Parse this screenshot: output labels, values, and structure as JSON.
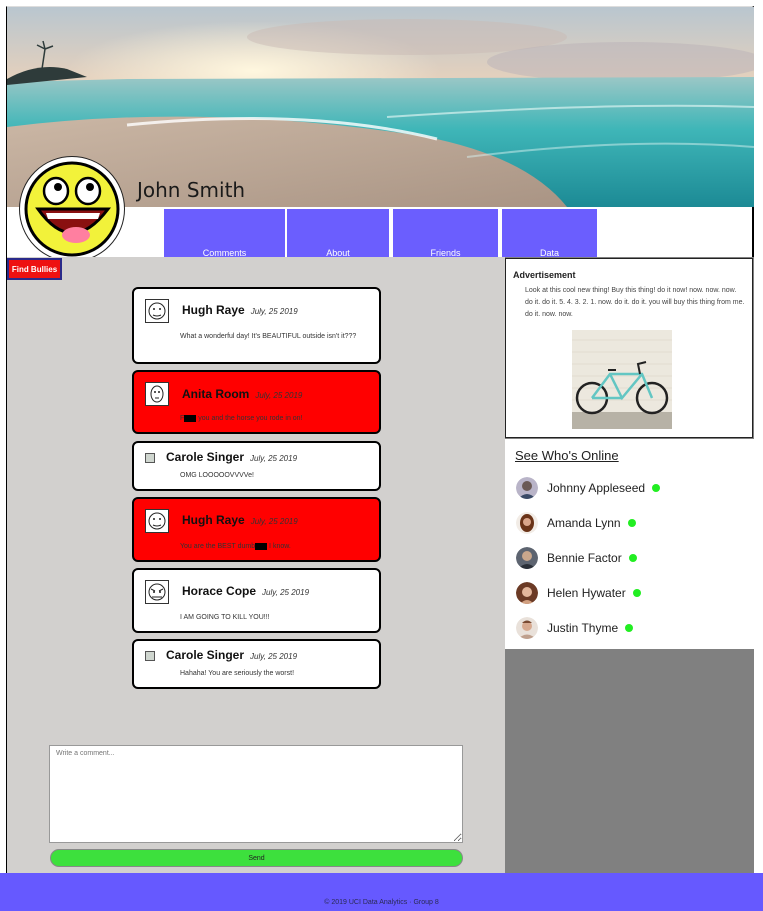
{
  "profile": {
    "name": "John Smith",
    "cover": "beach-sunset-photo",
    "avatar": "smiley-face-avatar"
  },
  "nav": {
    "tabs": [
      {
        "label": "Comments"
      },
      {
        "label": "About"
      },
      {
        "label": "Friends"
      },
      {
        "label": "Data"
      }
    ],
    "tab_color": "#6b5efe"
  },
  "find_bullies": {
    "label": "Find Bullies",
    "color": "#ee1111"
  },
  "comments": [
    {
      "author": "Hugh Raye",
      "date": "July, 25 2019",
      "text": "What a wonderful day! It's BEAUTIFUL outside isn't it???",
      "flagged": false,
      "avatar": "meme-face-avatar"
    },
    {
      "author": "Anita Room",
      "date": "July, 25 2019",
      "text_before": "F",
      "text_after": " you and the horse you rode in on!",
      "flagged": true,
      "avatar": "meme-face-avatar"
    },
    {
      "author": "Carole Singer",
      "date": "July, 25 2019",
      "text": "OMG LOOOOOVVVVe!",
      "flagged": false,
      "avatar": "broken-image-icon"
    },
    {
      "author": "Hugh Raye",
      "date": "July, 25 2019",
      "text_before": "You are the BEST dumb",
      "text_after": " I know.",
      "flagged": true,
      "avatar": "meme-face-avatar"
    },
    {
      "author": "Horace Cope",
      "date": "July, 25 2019",
      "text": "I AM GOING TO KILL YOU!!!",
      "flagged": false,
      "avatar": "meme-face-avatar"
    },
    {
      "author": "Carole Singer",
      "date": "July, 25 2019",
      "text": "Hahaha! You are seriously the worst!",
      "flagged": false,
      "avatar": "broken-image-icon"
    }
  ],
  "comment_form": {
    "placeholder": "Write a comment...",
    "send_label": "Send",
    "send_color": "#3de03d"
  },
  "advertisement": {
    "title": "Advertisement",
    "text": "Look at this cool new thing! Buy this thing! do it now! now. now. now. do it. do it. 5. 4. 3. 2. 1. now. do it. do it. you will buy this thing from me. do it. now. now.",
    "image": "bicycle-photo"
  },
  "online": {
    "title": "See Who's Online",
    "status_color": "#22ee22",
    "users": [
      {
        "name": "Johnny Appleseed"
      },
      {
        "name": "Amanda Lynn"
      },
      {
        "name": "Bennie Factor"
      },
      {
        "name": "Helen Hywater"
      },
      {
        "name": "Justin Thyme"
      }
    ]
  },
  "footer": {
    "text": "© 2019 UCI Data Analytics · Group 8"
  }
}
